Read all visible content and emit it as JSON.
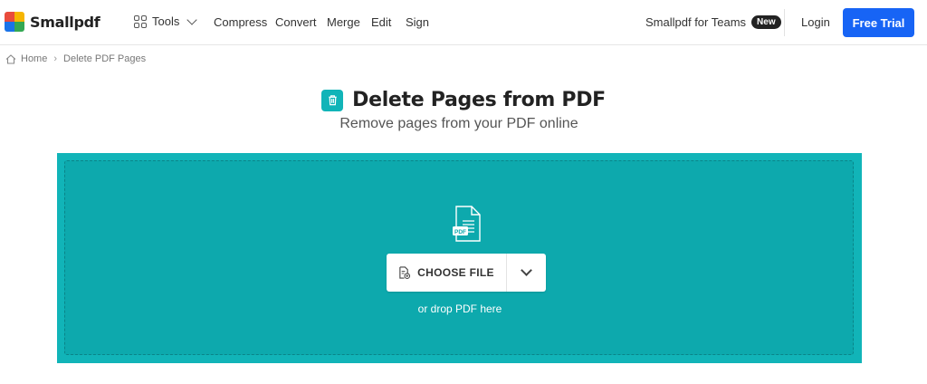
{
  "brand": {
    "name": "Smallpdf",
    "colors": [
      "#e94b3c",
      "#f6b500",
      "#1a73e8",
      "#34a853"
    ]
  },
  "header": {
    "tools_label": "Tools",
    "nav": [
      {
        "label": "Compress"
      },
      {
        "label": "Convert"
      },
      {
        "label": "Merge"
      },
      {
        "label": "Edit"
      },
      {
        "label": "Sign"
      }
    ],
    "teams_label": "Smallpdf for Teams",
    "new_badge": "New",
    "login_label": "Login",
    "trial_label": "Free Trial"
  },
  "breadcrumb": {
    "home": "Home",
    "current": "Delete PDF Pages"
  },
  "main": {
    "title": "Delete Pages from PDF",
    "subtitle": "Remove pages from your PDF online",
    "title_icon": "trash-icon"
  },
  "dropzone": {
    "file_badge": "PDF",
    "choose_label": "CHOOSE FILE",
    "drop_hint": "or drop PDF here",
    "accent": "#11b4b8"
  }
}
